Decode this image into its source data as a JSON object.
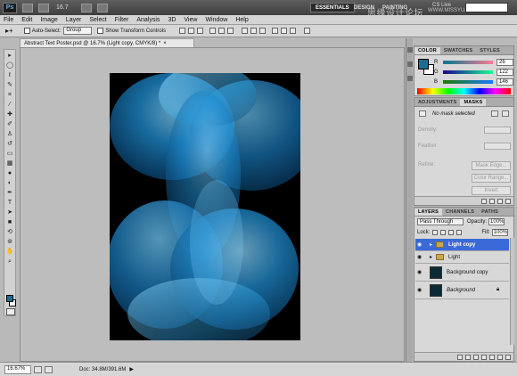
{
  "appbar": {
    "logo": "Ps",
    "zoom": "16.7",
    "workspaces": [
      "ESSENTIALS",
      "DESIGN",
      "PAINTING"
    ],
    "cs_live": "CS Live",
    "watermark": "思缘设计论坛",
    "watermark_url": "WWW.MISSYUAN.COM"
  },
  "menu": [
    "File",
    "Edit",
    "Image",
    "Layer",
    "Select",
    "Filter",
    "Analysis",
    "3D",
    "View",
    "Window",
    "Help"
  ],
  "options": {
    "auto_select_label": "Auto-Select:",
    "auto_select_value": "Group",
    "transform_label": "Show Transform Controls"
  },
  "document": {
    "tab_title": "Abstract Text Poster.psd @ 16.7% (Light copy, CMYK/8) *",
    "close": "×"
  },
  "status": {
    "zoom": "16.67%",
    "doc_info": "Doc: 34.8M/391.6M"
  },
  "color_panel": {
    "tabs": [
      "COLOR",
      "SWATCHES",
      "STYLES"
    ],
    "channels": [
      {
        "label": "R",
        "value": "26"
      },
      {
        "label": "G",
        "value": "122"
      },
      {
        "label": "B",
        "value": "146"
      }
    ],
    "foreground": "#1a7a92"
  },
  "adjustments_panel": {
    "tabs": [
      "ADJUSTMENTS",
      "MASKS"
    ],
    "no_mask": "No mask selected",
    "density": "Density:",
    "feather": "Feather:",
    "refine": "Refine:",
    "buttons": [
      "Mask Edge...",
      "Color Range...",
      "Invert"
    ]
  },
  "layers_panel": {
    "tabs": [
      "LAYERS",
      "CHANNELS",
      "PATHS"
    ],
    "blend_mode": "Pass Through",
    "opacity_label": "Opacity:",
    "opacity": "100%",
    "lock_label": "Lock:",
    "fill_label": "Fill:",
    "fill": "100%",
    "layers": [
      {
        "name": "Light copy",
        "kind": "group",
        "selected": true
      },
      {
        "name": "Light",
        "kind": "group",
        "selected": false
      },
      {
        "name": "Background copy",
        "kind": "image",
        "selected": false
      },
      {
        "name": "Background",
        "kind": "image",
        "selected": false
      }
    ]
  }
}
